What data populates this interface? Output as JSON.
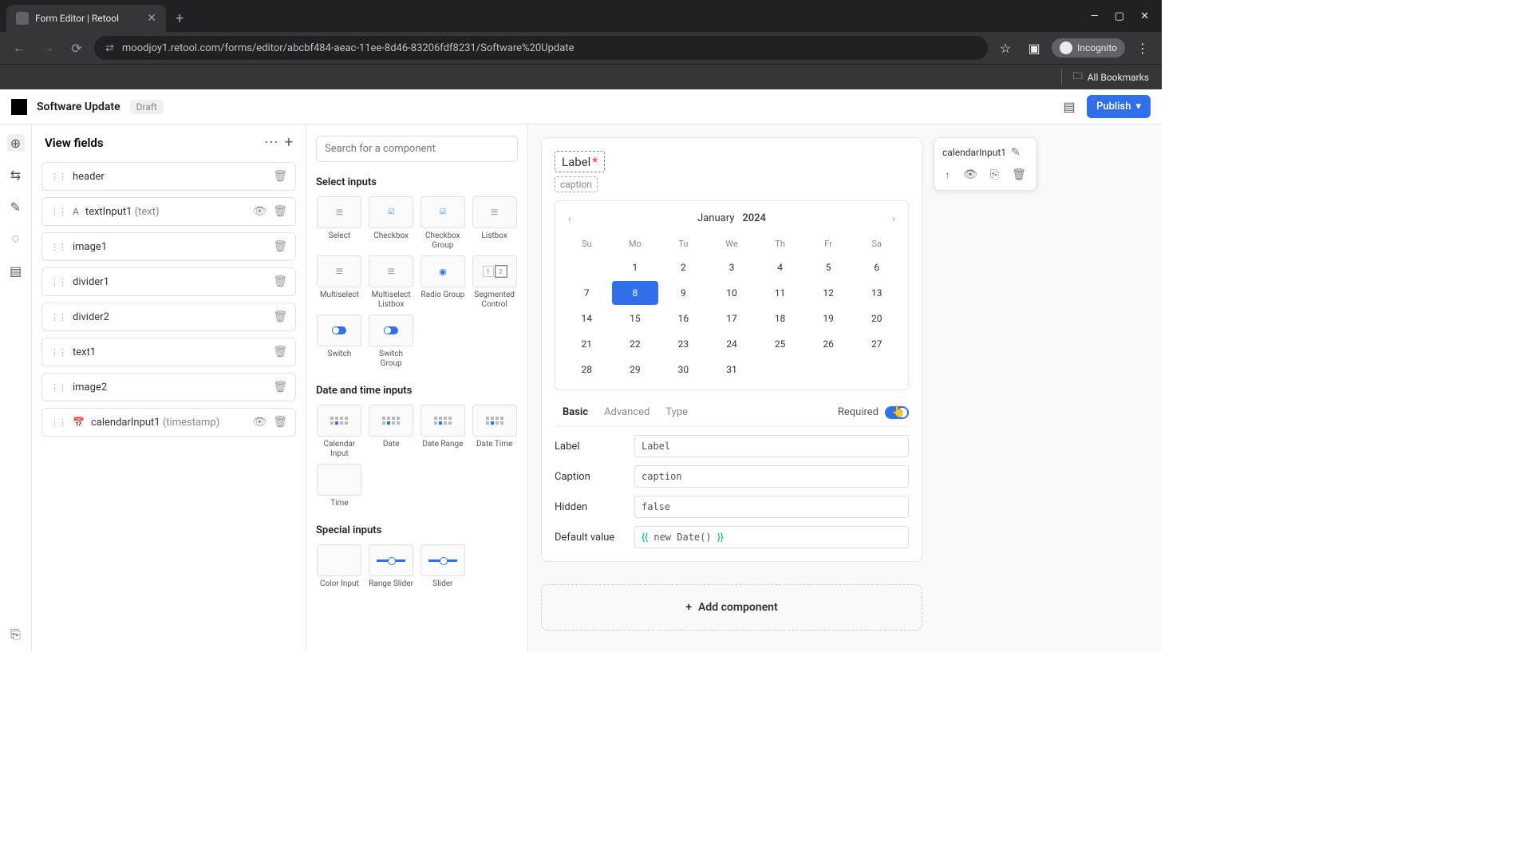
{
  "browser": {
    "tab_title": "Form Editor | Retool",
    "url": "moodjoy1.retool.com/forms/editor/abcbf484-aeac-11ee-8d46-83206fdf8231/Software%20Update",
    "incognito_label": "Incognito",
    "bookmarks_label": "All Bookmarks"
  },
  "app": {
    "title": "Software Update",
    "status": "Draft",
    "publish_label": "Publish"
  },
  "fields_panel": {
    "title": "View fields",
    "items": [
      {
        "label": "header",
        "meta": "",
        "icon": "",
        "visible": true
      },
      {
        "label": "textInput1",
        "meta": "(text)",
        "icon": "A",
        "visible": false
      },
      {
        "label": "image1",
        "meta": "",
        "icon": "",
        "visible": true
      },
      {
        "label": "divider1",
        "meta": "",
        "icon": "",
        "visible": true
      },
      {
        "label": "divider2",
        "meta": "",
        "icon": "",
        "visible": true
      },
      {
        "label": "text1",
        "meta": "",
        "icon": "",
        "visible": true
      },
      {
        "label": "image2",
        "meta": "",
        "icon": "",
        "visible": true
      },
      {
        "label": "calendarInput1",
        "meta": "(timestamp)",
        "icon": "📅",
        "visible": false
      }
    ]
  },
  "palette": {
    "search_placeholder": "Search for a component",
    "sections": [
      {
        "title": "Select inputs",
        "items": [
          "Select",
          "Checkbox",
          "Checkbox Group",
          "Listbox",
          "Multiselect",
          "Multiselect Listbox",
          "Radio Group",
          "Segmented Control",
          "Switch",
          "Switch Group"
        ]
      },
      {
        "title": "Date and time inputs",
        "items": [
          "Calendar Input",
          "Date",
          "Date Range",
          "Date Time",
          "Time"
        ]
      },
      {
        "title": "Special inputs",
        "items": [
          "Color Input",
          "Range Slider",
          "Slider"
        ]
      }
    ]
  },
  "preview": {
    "label": "Label",
    "caption": "caption",
    "calendar": {
      "month": "January",
      "year": "2024",
      "dow": [
        "Su",
        "Mo",
        "Tu",
        "We",
        "Th",
        "Fr",
        "Sa"
      ],
      "leading_blanks": 1,
      "days": 31,
      "selected": 8
    },
    "tabs": [
      "Basic",
      "Advanced",
      "Type"
    ],
    "active_tab": "Basic",
    "required_label": "Required",
    "required_on": true,
    "props": [
      {
        "label": "Label",
        "value": "Label"
      },
      {
        "label": "Caption",
        "value": "caption"
      },
      {
        "label": "Hidden",
        "value": "false"
      },
      {
        "label": "Default value",
        "value": "{{ new Date() }}",
        "template": true
      }
    ],
    "add_label": "Add component"
  },
  "floater": {
    "name": "calendarInput1"
  }
}
